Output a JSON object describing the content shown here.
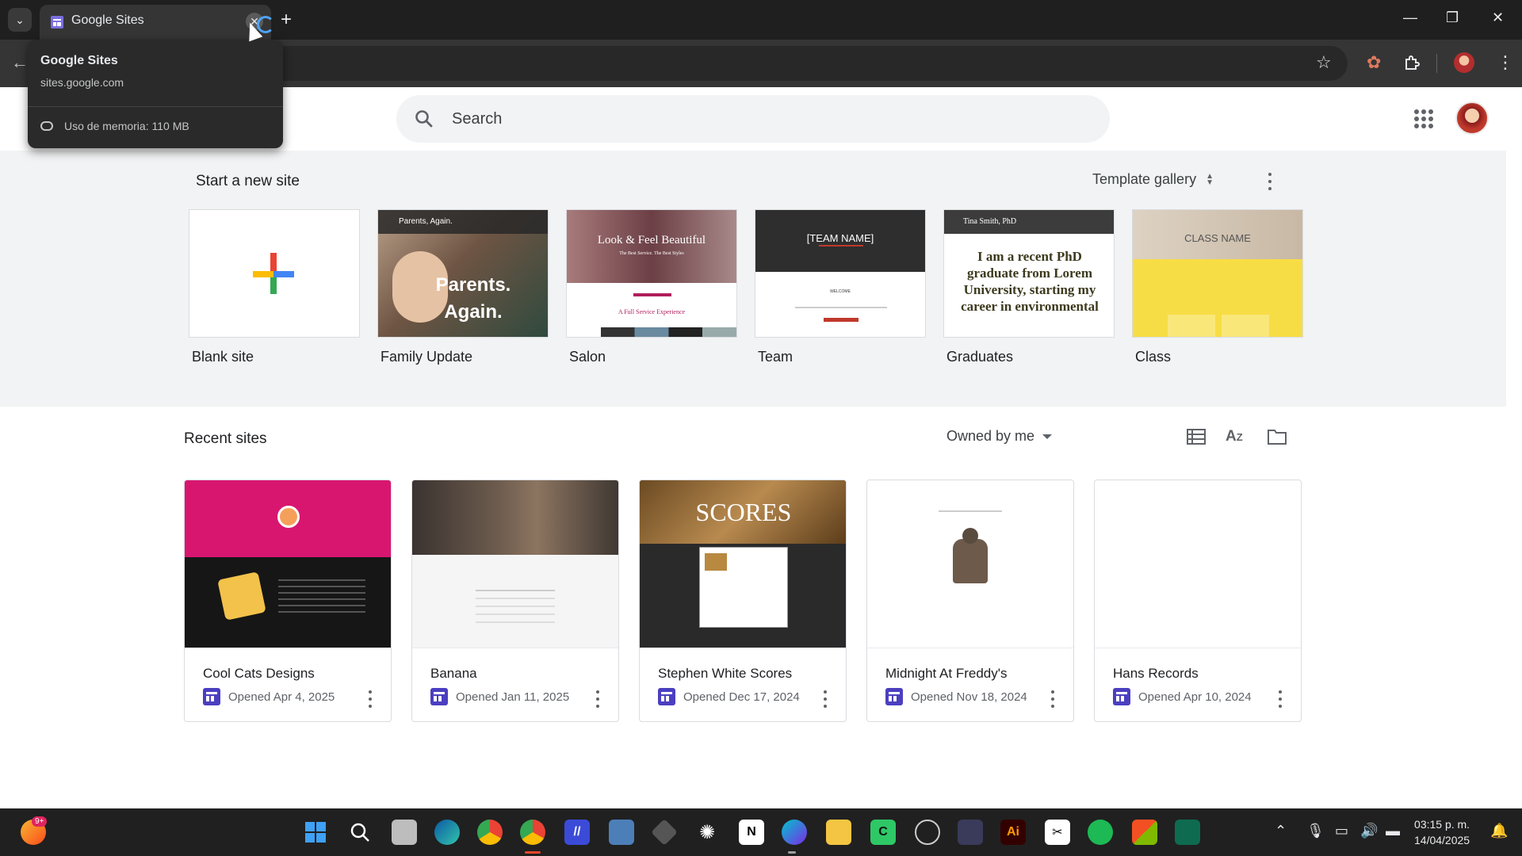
{
  "browser": {
    "tab_title": "Google Sites",
    "hovercard": {
      "title": "Google Sites",
      "url": "sites.google.com",
      "memory": "Uso de memoria: 110 MB"
    }
  },
  "header": {
    "search_placeholder": "Search"
  },
  "start": {
    "heading": "Start a new site",
    "template_gallery_label": "Template gallery",
    "templates": [
      {
        "label": "Blank site"
      },
      {
        "label": "Family Update",
        "thumb_title": "Parents. Again.",
        "thumb_bar": "Parents, Again."
      },
      {
        "label": "Salon",
        "thumb_title": "Look & Feel Beautiful",
        "thumb_sub": "The Best Service. The Best Styles",
        "thumb_foot": "A Full Service Experience"
      },
      {
        "label": "Team",
        "thumb_title": "[TEAM NAME]",
        "thumb_sub": "WELCOME"
      },
      {
        "label": "Graduates",
        "thumb_bar": "Tina Smith, PhD",
        "thumb_body": "I am a recent PhD graduate from Lorem University, starting my career in environmental"
      },
      {
        "label": "Class",
        "thumb_title": "CLASS NAME"
      }
    ]
  },
  "recent": {
    "heading": "Recent sites",
    "owned_label": "Owned by me",
    "sites": [
      {
        "title": "Cool Cats Designs",
        "opened": "Opened Apr 4, 2025"
      },
      {
        "title": "Banana",
        "opened": "Opened Jan 11, 2025"
      },
      {
        "title": "Stephen White Scores",
        "opened": "Opened Dec 17, 2024",
        "thumb_title": "SCORES"
      },
      {
        "title": "Midnight At Freddy's",
        "opened": "Opened Nov 18, 2024"
      },
      {
        "title": "Hans Records",
        "opened": "Opened Apr 10, 2024"
      }
    ]
  },
  "taskbar": {
    "notification_badge": "9+",
    "time": "03:15 p. m.",
    "date": "14/04/2025"
  },
  "colors": {
    "sites_purple": "#4b3fc0",
    "accent_blue": "#1a73e8",
    "section_bg": "#f1f3f4"
  }
}
